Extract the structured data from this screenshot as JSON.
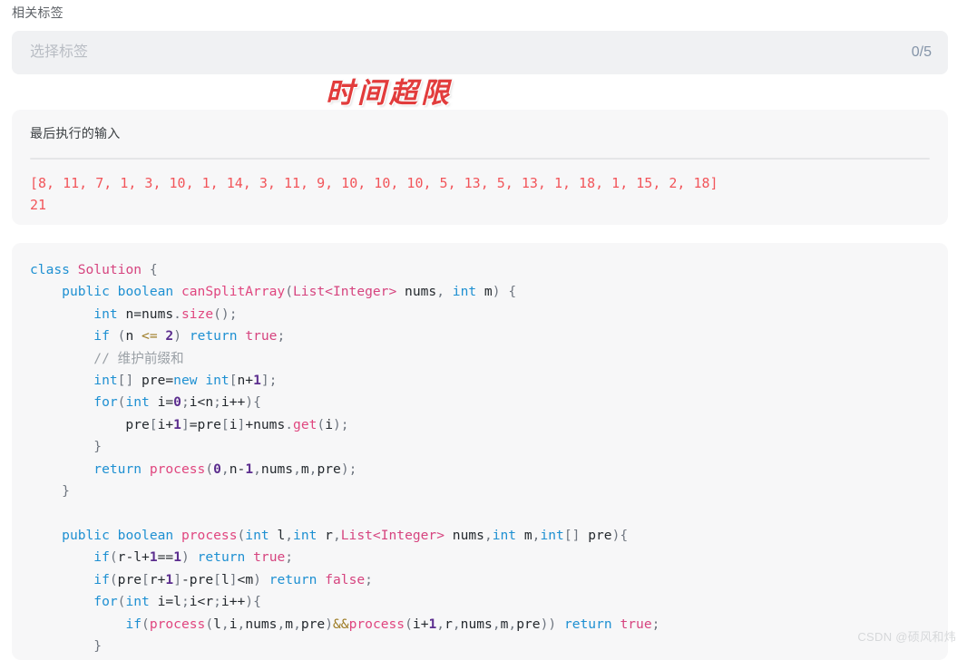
{
  "tags_section": {
    "label": "相关标签",
    "select_placeholder": "选择标签",
    "counter": "0/5",
    "counter_color": "#8494a8",
    "field_background": "#f0f1f3"
  },
  "verdict": {
    "text": "时间超限",
    "color": "#e23c3c"
  },
  "last_input_card": {
    "title": "最后执行的输入",
    "value_color": "#f2555a",
    "lines": [
      "[8, 11, 7, 1, 3, 10, 1, 14, 3, 11, 9, 10, 10, 10, 5, 13, 5, 13, 1, 18, 1, 15, 2, 18]",
      "21"
    ]
  },
  "code_card": {
    "language": "java",
    "theme": {
      "background": "#f7f7f8",
      "keyword": "#1e90d2",
      "type": "#d6447f",
      "function": "#e0467f",
      "number": "#5b2d8e",
      "comment": "#9aa0a6",
      "operator": "#9c7a22",
      "punctuation": "#6f7680",
      "plain": "#24292e"
    },
    "lines": [
      [
        {
          "t": "class",
          "c": "kw"
        },
        {
          "t": " ",
          "c": "pl"
        },
        {
          "t": "Solution",
          "c": "typ"
        },
        {
          "t": " ",
          "c": "pl"
        },
        {
          "t": "{",
          "c": "pn"
        }
      ],
      [
        {
          "t": "    ",
          "c": "pl"
        },
        {
          "t": "public",
          "c": "kw"
        },
        {
          "t": " ",
          "c": "pl"
        },
        {
          "t": "boolean",
          "c": "kw"
        },
        {
          "t": " ",
          "c": "pl"
        },
        {
          "t": "canSplitArray",
          "c": "fn"
        },
        {
          "t": "(",
          "c": "pn"
        },
        {
          "t": "List",
          "c": "typ"
        },
        {
          "t": "<Integer>",
          "c": "typ"
        },
        {
          "t": " nums",
          "c": "pl"
        },
        {
          "t": ",",
          "c": "pn"
        },
        {
          "t": " ",
          "c": "pl"
        },
        {
          "t": "int",
          "c": "kw"
        },
        {
          "t": " m",
          "c": "pl"
        },
        {
          "t": ")",
          "c": "pn"
        },
        {
          "t": " ",
          "c": "pl"
        },
        {
          "t": "{",
          "c": "pn"
        }
      ],
      [
        {
          "t": "        ",
          "c": "pl"
        },
        {
          "t": "int",
          "c": "kw"
        },
        {
          "t": " n=nums",
          "c": "pl"
        },
        {
          "t": ".",
          "c": "pn"
        },
        {
          "t": "size",
          "c": "fn"
        },
        {
          "t": "();",
          "c": "pn"
        }
      ],
      [
        {
          "t": "        ",
          "c": "pl"
        },
        {
          "t": "if",
          "c": "kw"
        },
        {
          "t": " ",
          "c": "pl"
        },
        {
          "t": "(",
          "c": "pn"
        },
        {
          "t": "n ",
          "c": "pl"
        },
        {
          "t": "<=",
          "c": "op"
        },
        {
          "t": " ",
          "c": "pl"
        },
        {
          "t": "2",
          "c": "num"
        },
        {
          "t": ")",
          "c": "pn"
        },
        {
          "t": " ",
          "c": "pl"
        },
        {
          "t": "return",
          "c": "kw"
        },
        {
          "t": " ",
          "c": "pl"
        },
        {
          "t": "true",
          "c": "typ"
        },
        {
          "t": ";",
          "c": "pn"
        }
      ],
      [
        {
          "t": "        ",
          "c": "pl"
        },
        {
          "t": "// 维护前缀和",
          "c": "cmt"
        }
      ],
      [
        {
          "t": "        ",
          "c": "pl"
        },
        {
          "t": "int",
          "c": "kw"
        },
        {
          "t": "[]",
          "c": "pn"
        },
        {
          "t": " pre=",
          "c": "pl"
        },
        {
          "t": "new",
          "c": "kw"
        },
        {
          "t": " ",
          "c": "pl"
        },
        {
          "t": "int",
          "c": "kw"
        },
        {
          "t": "[",
          "c": "pn"
        },
        {
          "t": "n+",
          "c": "pl"
        },
        {
          "t": "1",
          "c": "num"
        },
        {
          "t": "];",
          "c": "pn"
        }
      ],
      [
        {
          "t": "        ",
          "c": "pl"
        },
        {
          "t": "for",
          "c": "kw"
        },
        {
          "t": "(",
          "c": "pn"
        },
        {
          "t": "int",
          "c": "kw"
        },
        {
          "t": " i=",
          "c": "pl"
        },
        {
          "t": "0",
          "c": "num"
        },
        {
          "t": ";",
          "c": "pn"
        },
        {
          "t": "i<n",
          "c": "pl"
        },
        {
          "t": ";",
          "c": "pn"
        },
        {
          "t": "i++",
          "c": "pl"
        },
        {
          "t": "){",
          "c": "pn"
        }
      ],
      [
        {
          "t": "            pre",
          "c": "pl"
        },
        {
          "t": "[",
          "c": "pn"
        },
        {
          "t": "i+",
          "c": "pl"
        },
        {
          "t": "1",
          "c": "num"
        },
        {
          "t": "]",
          "c": "pn"
        },
        {
          "t": "=pre",
          "c": "pl"
        },
        {
          "t": "[",
          "c": "pn"
        },
        {
          "t": "i",
          "c": "pl"
        },
        {
          "t": "]",
          "c": "pn"
        },
        {
          "t": "+nums",
          "c": "pl"
        },
        {
          "t": ".",
          "c": "pn"
        },
        {
          "t": "get",
          "c": "fn"
        },
        {
          "t": "(",
          "c": "pn"
        },
        {
          "t": "i",
          "c": "pl"
        },
        {
          "t": ");",
          "c": "pn"
        }
      ],
      [
        {
          "t": "        ",
          "c": "pl"
        },
        {
          "t": "}",
          "c": "pn"
        }
      ],
      [
        {
          "t": "        ",
          "c": "pl"
        },
        {
          "t": "return",
          "c": "kw"
        },
        {
          "t": " ",
          "c": "pl"
        },
        {
          "t": "process",
          "c": "fn"
        },
        {
          "t": "(",
          "c": "pn"
        },
        {
          "t": "0",
          "c": "num"
        },
        {
          "t": ",",
          "c": "pn"
        },
        {
          "t": "n",
          "c": "pl"
        },
        {
          "t": "-",
          "c": "pl"
        },
        {
          "t": "1",
          "c": "num"
        },
        {
          "t": ",",
          "c": "pn"
        },
        {
          "t": "nums",
          "c": "pl"
        },
        {
          "t": ",",
          "c": "pn"
        },
        {
          "t": "m",
          "c": "pl"
        },
        {
          "t": ",",
          "c": "pn"
        },
        {
          "t": "pre",
          "c": "pl"
        },
        {
          "t": ");",
          "c": "pn"
        }
      ],
      [
        {
          "t": "    ",
          "c": "pl"
        },
        {
          "t": "}",
          "c": "pn"
        }
      ],
      [
        {
          "t": "",
          "c": "pl"
        }
      ],
      [
        {
          "t": "    ",
          "c": "pl"
        },
        {
          "t": "public",
          "c": "kw"
        },
        {
          "t": " ",
          "c": "pl"
        },
        {
          "t": "boolean",
          "c": "kw"
        },
        {
          "t": " ",
          "c": "pl"
        },
        {
          "t": "process",
          "c": "fn"
        },
        {
          "t": "(",
          "c": "pn"
        },
        {
          "t": "int",
          "c": "kw"
        },
        {
          "t": " l",
          "c": "pl"
        },
        {
          "t": ",",
          "c": "pn"
        },
        {
          "t": "int",
          "c": "kw"
        },
        {
          "t": " r",
          "c": "pl"
        },
        {
          "t": ",",
          "c": "pn"
        },
        {
          "t": "List",
          "c": "typ"
        },
        {
          "t": "<Integer>",
          "c": "typ"
        },
        {
          "t": " nums",
          "c": "pl"
        },
        {
          "t": ",",
          "c": "pn"
        },
        {
          "t": "int",
          "c": "kw"
        },
        {
          "t": " m",
          "c": "pl"
        },
        {
          "t": ",",
          "c": "pn"
        },
        {
          "t": "int",
          "c": "kw"
        },
        {
          "t": "[]",
          "c": "pn"
        },
        {
          "t": " pre",
          "c": "pl"
        },
        {
          "t": "){",
          "c": "pn"
        }
      ],
      [
        {
          "t": "        ",
          "c": "pl"
        },
        {
          "t": "if",
          "c": "kw"
        },
        {
          "t": "(",
          "c": "pn"
        },
        {
          "t": "r",
          "c": "pl"
        },
        {
          "t": "-",
          "c": "pl"
        },
        {
          "t": "l+",
          "c": "pl"
        },
        {
          "t": "1",
          "c": "num"
        },
        {
          "t": "==",
          "c": "pl"
        },
        {
          "t": "1",
          "c": "num"
        },
        {
          "t": ")",
          "c": "pn"
        },
        {
          "t": " ",
          "c": "pl"
        },
        {
          "t": "return",
          "c": "kw"
        },
        {
          "t": " ",
          "c": "pl"
        },
        {
          "t": "true",
          "c": "typ"
        },
        {
          "t": ";",
          "c": "pn"
        }
      ],
      [
        {
          "t": "        ",
          "c": "pl"
        },
        {
          "t": "if",
          "c": "kw"
        },
        {
          "t": "(",
          "c": "pn"
        },
        {
          "t": "pre",
          "c": "pl"
        },
        {
          "t": "[",
          "c": "pn"
        },
        {
          "t": "r+",
          "c": "pl"
        },
        {
          "t": "1",
          "c": "num"
        },
        {
          "t": "]",
          "c": "pn"
        },
        {
          "t": "-",
          "c": "pl"
        },
        {
          "t": "pre",
          "c": "pl"
        },
        {
          "t": "[",
          "c": "pn"
        },
        {
          "t": "l",
          "c": "pl"
        },
        {
          "t": "]",
          "c": "pn"
        },
        {
          "t": "<m",
          "c": "pl"
        },
        {
          "t": ")",
          "c": "pn"
        },
        {
          "t": " ",
          "c": "pl"
        },
        {
          "t": "return",
          "c": "kw"
        },
        {
          "t": " ",
          "c": "pl"
        },
        {
          "t": "false",
          "c": "typ"
        },
        {
          "t": ";",
          "c": "pn"
        }
      ],
      [
        {
          "t": "        ",
          "c": "pl"
        },
        {
          "t": "for",
          "c": "kw"
        },
        {
          "t": "(",
          "c": "pn"
        },
        {
          "t": "int",
          "c": "kw"
        },
        {
          "t": " i=l",
          "c": "pl"
        },
        {
          "t": ";",
          "c": "pn"
        },
        {
          "t": "i<r",
          "c": "pl"
        },
        {
          "t": ";",
          "c": "pn"
        },
        {
          "t": "i++",
          "c": "pl"
        },
        {
          "t": "){",
          "c": "pn"
        }
      ],
      [
        {
          "t": "            ",
          "c": "pl"
        },
        {
          "t": "if",
          "c": "kw"
        },
        {
          "t": "(",
          "c": "pn"
        },
        {
          "t": "process",
          "c": "fn"
        },
        {
          "t": "(",
          "c": "pn"
        },
        {
          "t": "l",
          "c": "pl"
        },
        {
          "t": ",",
          "c": "pn"
        },
        {
          "t": "i",
          "c": "pl"
        },
        {
          "t": ",",
          "c": "pn"
        },
        {
          "t": "nums",
          "c": "pl"
        },
        {
          "t": ",",
          "c": "pn"
        },
        {
          "t": "m",
          "c": "pl"
        },
        {
          "t": ",",
          "c": "pn"
        },
        {
          "t": "pre",
          "c": "pl"
        },
        {
          "t": ")",
          "c": "pn"
        },
        {
          "t": "&&",
          "c": "op"
        },
        {
          "t": "process",
          "c": "fn"
        },
        {
          "t": "(",
          "c": "pn"
        },
        {
          "t": "i+",
          "c": "pl"
        },
        {
          "t": "1",
          "c": "num"
        },
        {
          "t": ",",
          "c": "pn"
        },
        {
          "t": "r",
          "c": "pl"
        },
        {
          "t": ",",
          "c": "pn"
        },
        {
          "t": "nums",
          "c": "pl"
        },
        {
          "t": ",",
          "c": "pn"
        },
        {
          "t": "m",
          "c": "pl"
        },
        {
          "t": ",",
          "c": "pn"
        },
        {
          "t": "pre",
          "c": "pl"
        },
        {
          "t": "))",
          "c": "pn"
        },
        {
          "t": " ",
          "c": "pl"
        },
        {
          "t": "return",
          "c": "kw"
        },
        {
          "t": " ",
          "c": "pl"
        },
        {
          "t": "true",
          "c": "typ"
        },
        {
          "t": ";",
          "c": "pn"
        }
      ],
      [
        {
          "t": "        ",
          "c": "pl"
        },
        {
          "t": "}",
          "c": "pn"
        }
      ]
    ]
  },
  "watermark": {
    "text": "CSDN @硕风和炜"
  }
}
